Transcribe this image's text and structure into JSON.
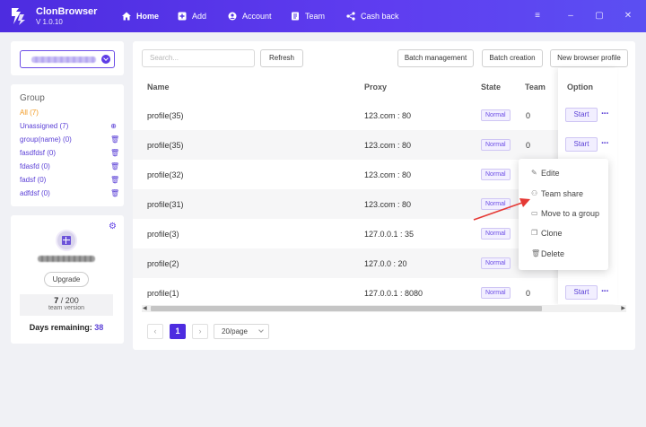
{
  "app": {
    "name": "ClonBrowser",
    "version": "V 1.0.10"
  },
  "nav": [
    {
      "label": "Home",
      "icon": "home-icon",
      "active": true
    },
    {
      "label": "Add",
      "icon": "plus-square-icon"
    },
    {
      "label": "Account",
      "icon": "account-icon"
    },
    {
      "label": "Team",
      "icon": "team-icon"
    },
    {
      "label": "Cash back",
      "icon": "share-icon"
    }
  ],
  "window_controls": [
    "menu-icon",
    "minimize-icon",
    "maximize-icon",
    "close-icon"
  ],
  "sidebar": {
    "groups_title": "Group",
    "groups": [
      {
        "label": "All  (7)"
      },
      {
        "label": "Unassigned  (7)",
        "icon": "add-circle-icon"
      },
      {
        "label": "group(name)  (0)",
        "icon": "trash-icon"
      },
      {
        "label": "fasdfdsf  (0)",
        "icon": "trash-icon"
      },
      {
        "label": "fdasfd  (0)",
        "icon": "trash-icon"
      },
      {
        "label": "fadsf  (0)",
        "icon": "trash-icon"
      },
      {
        "label": "adfdsf  (0)",
        "icon": "trash-icon"
      }
    ],
    "upgrade_label": "Upgrade",
    "team_count": "7",
    "team_limit": " / 200",
    "team_label": "team version",
    "days_label": "Days remaining: ",
    "days_value": "38"
  },
  "toolbar": {
    "search_placeholder": "Search...",
    "refresh": "Refresh",
    "batch_management": "Batch management",
    "batch_creation": "Batch creation",
    "new_profile": "New browser profile"
  },
  "table": {
    "headers": {
      "name": "Name",
      "proxy": "Proxy",
      "state": "State",
      "team": "Team",
      "option": "Option"
    },
    "rows": [
      {
        "name": "profile(35)",
        "proxy": "123.com : 80",
        "state": "Normal",
        "team": "0"
      },
      {
        "name": "profile(35)",
        "proxy": "123.com : 80",
        "state": "Normal",
        "team": "0"
      },
      {
        "name": "profile(32)",
        "proxy": "123.com : 80",
        "state": "Normal",
        "team": ""
      },
      {
        "name": "profile(31)",
        "proxy": "123.com : 80",
        "state": "Normal",
        "team": ""
      },
      {
        "name": "profile(3)",
        "proxy": "127.0.0.1 : 35",
        "state": "Normal",
        "team": ""
      },
      {
        "name": "profile(2)",
        "proxy": "127.0.0 : 20",
        "state": "Normal",
        "team": ""
      },
      {
        "name": "profile(1)",
        "proxy": "127.0.0.1 : 8080",
        "state": "Normal",
        "team": "0"
      }
    ],
    "start_label": "Start",
    "more_label": "···"
  },
  "pagination": {
    "prev": "‹",
    "current": "1",
    "next": "›",
    "page_size": "20/page"
  },
  "context_menu": [
    {
      "label": "Edite",
      "icon": "edit-icon"
    },
    {
      "label": "Team share",
      "icon": "user-icon"
    },
    {
      "label": "Move to a group",
      "icon": "folder-icon"
    },
    {
      "label": "Clone",
      "icon": "copy-icon"
    },
    {
      "label": "Delete",
      "icon": "trash-icon"
    }
  ],
  "colors": {
    "accent": "#5e3de6",
    "header_start": "#4d2ce0",
    "annotation_arrow": "#e53935"
  }
}
